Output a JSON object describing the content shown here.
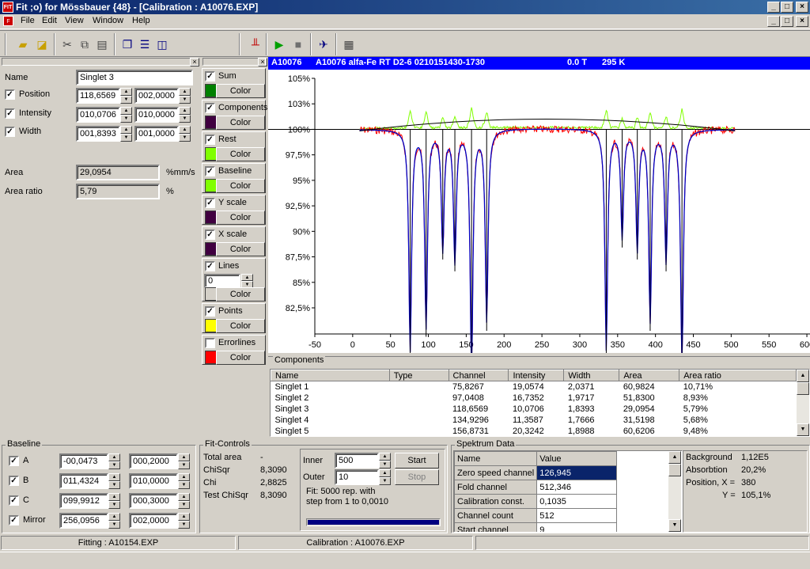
{
  "window": {
    "title": "Fit ;o) for Mössbauer {48} - [Calibration : A10076.EXP]",
    "icon": "fit-app-icon"
  },
  "menu": {
    "file": "File",
    "edit": "Edit",
    "view": "View",
    "window": "Window",
    "help": "Help"
  },
  "component_panel": {
    "name_label": "Name",
    "name_value": "Singlet 3",
    "position_label": "Position",
    "position_value": "118,6569",
    "position_step": "002,0000",
    "intensity_label": "Intensity",
    "intensity_value": "010,0706",
    "intensity_step": "010,0000",
    "width_label": "Width",
    "width_value": "001,8393",
    "width_step": "001,0000",
    "area_label": "Area",
    "area_value": "29,0954",
    "area_unit": "%mm/s",
    "ratio_label": "Area ratio",
    "ratio_value": "5,79",
    "ratio_unit": "%"
  },
  "display_panel": {
    "color_label": "Color",
    "items": [
      {
        "label": "Sum",
        "checked": true,
        "color": "#008000"
      },
      {
        "label": "Components",
        "checked": true,
        "color": "#400040"
      },
      {
        "label": "Rest",
        "checked": true,
        "color": "#80ff00"
      },
      {
        "label": "Baseline",
        "checked": true,
        "color": "#80ff00"
      },
      {
        "label": "Y scale",
        "checked": true,
        "color": "#400040"
      },
      {
        "label": "X scale",
        "checked": true,
        "color": "#400040"
      },
      {
        "label": "Lines",
        "checked": true,
        "color": "#d4d0c8",
        "value": "0"
      },
      {
        "label": "Points",
        "checked": true,
        "color": "#ffff00"
      },
      {
        "label": "Errorlines",
        "checked": false,
        "color": "#ff0000"
      }
    ]
  },
  "chart_header": {
    "id": "A10076",
    "description": "A10076 alfa-Fe RT D2-6 0210151430-1730",
    "field": "0.0 T",
    "temp": "295 K"
  },
  "chart_data": {
    "type": "line",
    "xticks": [
      "-50",
      "0",
      "50",
      "100",
      "150",
      "200",
      "250",
      "300",
      "350",
      "400",
      "450",
      "500",
      "550",
      "600"
    ],
    "yticks": [
      "105%",
      "103%",
      "100%",
      "97,5%",
      "95%",
      "92,5%",
      "90%",
      "87,5%",
      "85%",
      "82,5%"
    ],
    "xlim": [
      -50,
      600
    ],
    "ylim": [
      82.5,
      105
    ],
    "baseline": 100,
    "peaks": [
      {
        "x": 76,
        "depth": 18.5
      },
      {
        "x": 97,
        "depth": 16.5
      },
      {
        "x": 119,
        "depth": 10
      },
      {
        "x": 135,
        "depth": 11
      },
      {
        "x": 157,
        "depth": 20
      },
      {
        "x": 177,
        "depth": 16
      },
      {
        "x": 335,
        "depth": 18.5
      },
      {
        "x": 356,
        "depth": 9
      },
      {
        "x": 376,
        "depth": 10
      },
      {
        "x": 393,
        "depth": 16
      },
      {
        "x": 414,
        "depth": 11
      },
      {
        "x": 435,
        "depth": 19.5
      }
    ],
    "colors": {
      "data": "#ff0000",
      "sum": "#0000c0",
      "rest": "#80ff00",
      "baseline": "#000000",
      "lines": "#000000"
    }
  },
  "components_table": {
    "title": "Components",
    "headers": [
      "Name",
      "Type",
      "Channel",
      "Intensity",
      "Width",
      "Area",
      "Area ratio"
    ],
    "rows": [
      [
        "Singlet 1",
        "",
        "75,8267",
        "19,0574",
        "2,0371",
        "60,9824",
        "10,71%"
      ],
      [
        "Singlet 2",
        "",
        "97,0408",
        "16,7352",
        "1,9717",
        "51,8300",
        "8,93%"
      ],
      [
        "Singlet 3",
        "",
        "118,6569",
        "10,0706",
        "1,8393",
        "29,0954",
        "5,79%"
      ],
      [
        "Singlet 4",
        "",
        "134,9296",
        "11,3587",
        "1,7666",
        "31,5198",
        "5,68%"
      ],
      [
        "Singlet 5",
        "",
        "156,8731",
        "20,3242",
        "1,8988",
        "60,6206",
        "9,48%"
      ]
    ]
  },
  "baseline_panel": {
    "title": "Baseline",
    "rows": [
      {
        "label": "A",
        "value": "-00,0473",
        "step": "000,2000"
      },
      {
        "label": "B",
        "value": "011,4324",
        "step": "010,0000"
      },
      {
        "label": "C",
        "value": "099,9912",
        "step": "000,3000"
      },
      {
        "label": "Mirror",
        "value": "256,0956",
        "step": "002,0000"
      }
    ]
  },
  "fit_controls": {
    "title": "Fit-Controls",
    "stats": [
      {
        "label": "Total area",
        "value": "-"
      },
      {
        "label": "ChiSqr",
        "value": "8,3090"
      },
      {
        "label": "Chi",
        "value": "2,8825"
      },
      {
        "label": "Test ChiSqr",
        "value": "8,3090"
      }
    ],
    "inner_label": "Inner",
    "inner_value": "500",
    "outer_label": "Outer",
    "outer_value": "10",
    "info_line1": "Fit: 5000 rep. with",
    "info_line2": "step from 1 to 0,0010",
    "start": "Start",
    "stop": "Stop"
  },
  "spectrum": {
    "title": "Spektrum Data",
    "headers": [
      "Name",
      "Value"
    ],
    "rows": [
      [
        "Zero speed channel",
        "126,945"
      ],
      [
        "Fold channel",
        "512,346"
      ],
      [
        "Calibration const.",
        "0,1035"
      ],
      [
        "Channel count",
        "512"
      ],
      [
        "Start channel",
        "9"
      ]
    ],
    "info": [
      {
        "label": "Background",
        "value": "1,12E5"
      },
      {
        "label": "Absorbtion",
        "value": "20,2%"
      },
      {
        "label": "Position, X =",
        "value": "380"
      },
      {
        "label": "Y =",
        "value": "105,1%"
      }
    ]
  },
  "statusbar": {
    "fitting": "Fitting : A10154.EXP",
    "calibration": "Calibration : A10076.EXP"
  }
}
